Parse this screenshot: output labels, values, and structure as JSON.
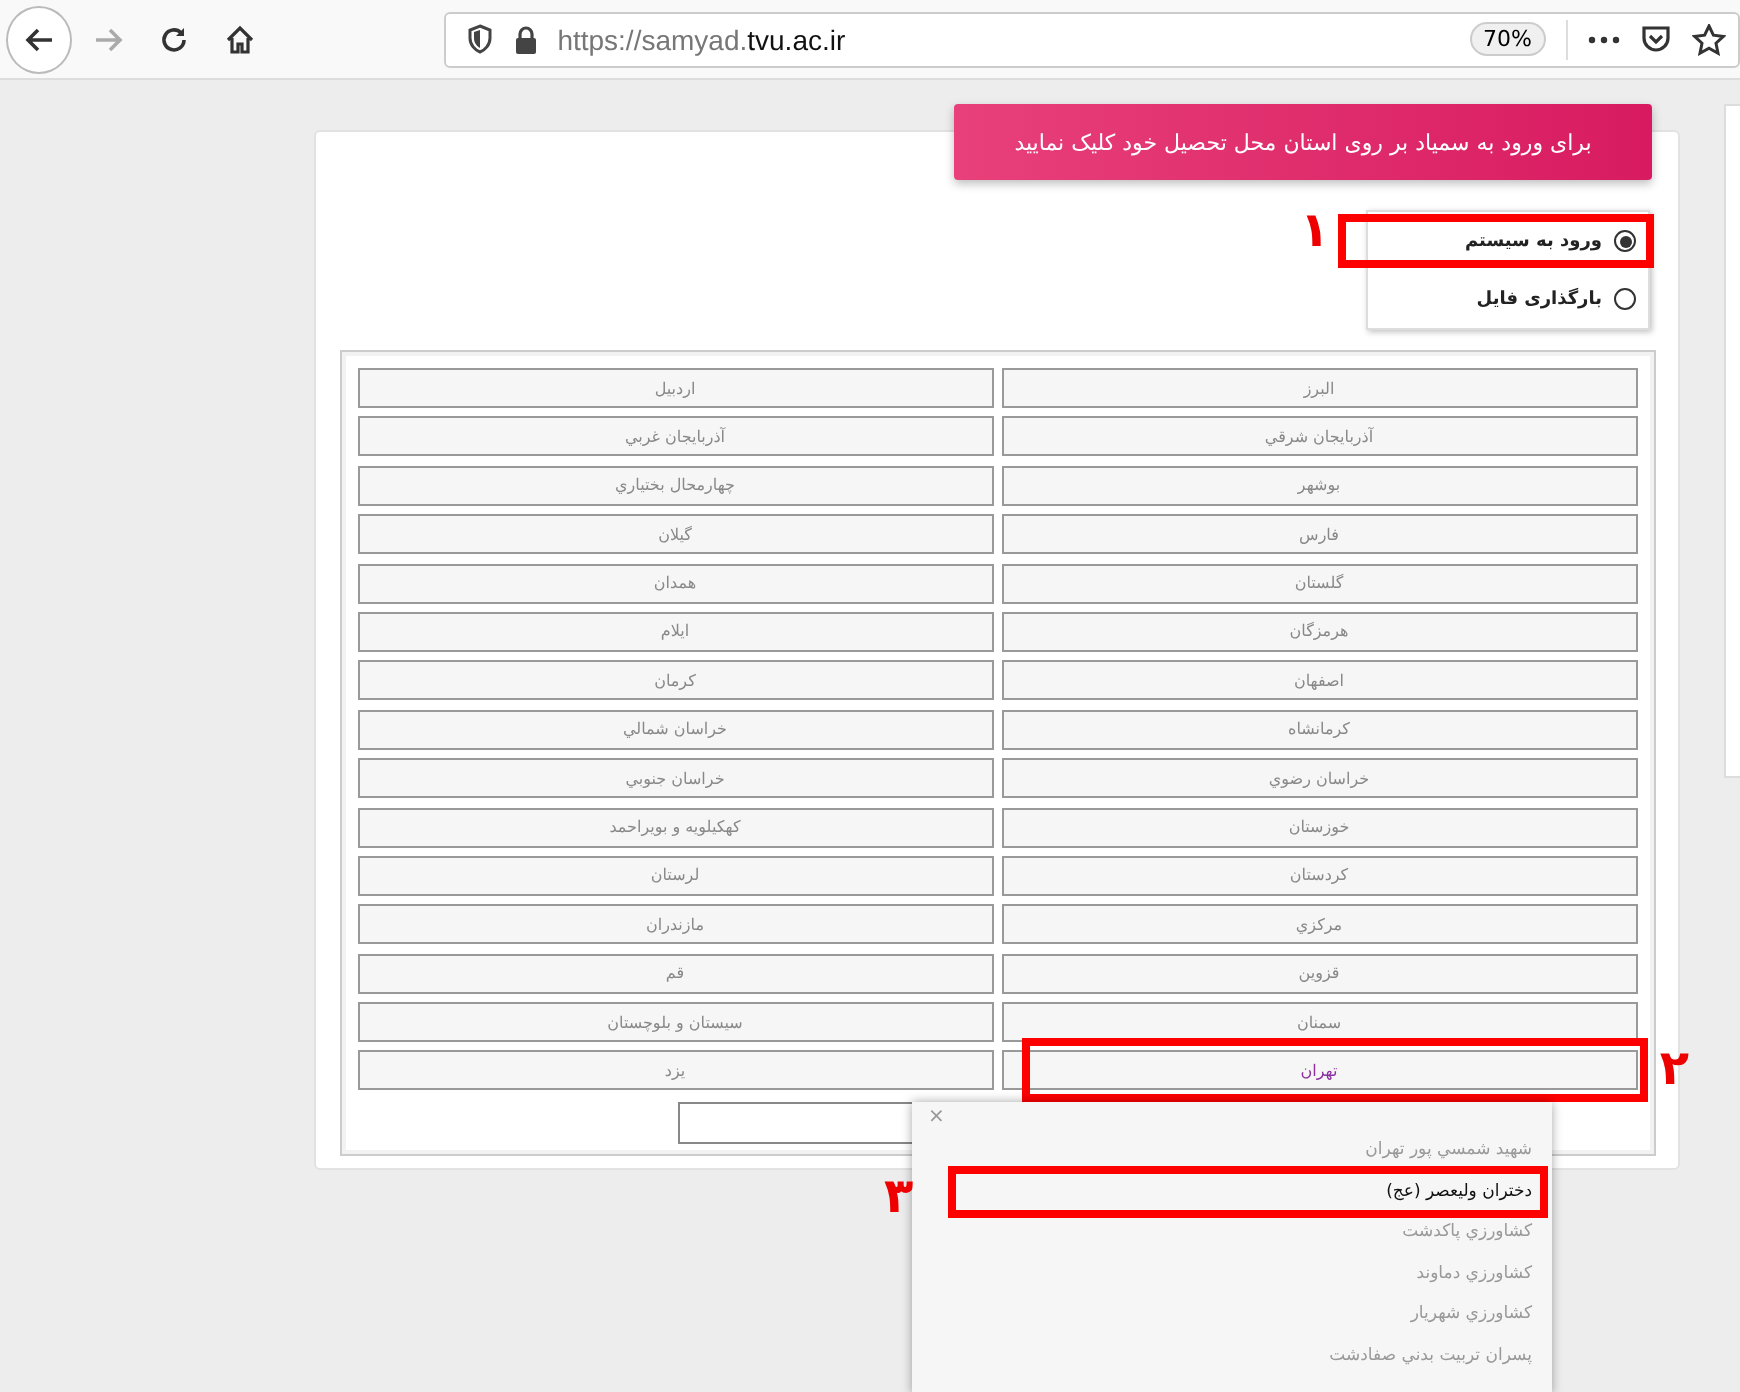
{
  "browser": {
    "url_prefix": "https://samyad.",
    "url_host": "tvu.ac.ir",
    "zoom": "70%",
    "forward_disabled": true
  },
  "banner": "برای ورود به سمیاد بر روی استان محل تحصیل خود کلیک نمایید",
  "modes": [
    {
      "label": "ورود به سیستم",
      "selected": true,
      "annotation": "۱"
    },
    {
      "label": "بارگذاری فایل",
      "selected": false
    }
  ],
  "provinces": [
    {
      "label": "البرز",
      "selected": false
    },
    {
      "label": "اردبيل",
      "selected": false
    },
    {
      "label": "آذربايجان شرقي",
      "selected": false
    },
    {
      "label": "آذربايجان غربي",
      "selected": false
    },
    {
      "label": "بوشهر",
      "selected": false
    },
    {
      "label": "چهارمحال بختياري",
      "selected": false
    },
    {
      "label": "فارس",
      "selected": false
    },
    {
      "label": "گيلان",
      "selected": false
    },
    {
      "label": "گلستان",
      "selected": false
    },
    {
      "label": "همدان",
      "selected": false
    },
    {
      "label": "هرمزگان",
      "selected": false
    },
    {
      "label": "ايلام",
      "selected": false
    },
    {
      "label": "اصفهان",
      "selected": false
    },
    {
      "label": "كرمان",
      "selected": false
    },
    {
      "label": "كرمانشاه",
      "selected": false
    },
    {
      "label": "خراسان شمالي",
      "selected": false
    },
    {
      "label": "خراسان رضوي",
      "selected": false
    },
    {
      "label": "خراسان جنوبي",
      "selected": false
    },
    {
      "label": "خوزستان",
      "selected": false
    },
    {
      "label": "كهكيلويه و بويراحمد",
      "selected": false
    },
    {
      "label": "كردستان",
      "selected": false
    },
    {
      "label": "لرستان",
      "selected": false
    },
    {
      "label": "مركزي",
      "selected": false
    },
    {
      "label": "مازندران",
      "selected": false
    },
    {
      "label": "قزوين",
      "selected": false
    },
    {
      "label": "قم",
      "selected": false
    },
    {
      "label": "سمنان",
      "selected": false
    },
    {
      "label": "سيستان و بلوچستان",
      "selected": false
    },
    {
      "label": "تهران",
      "selected": true,
      "annotation": "۲"
    },
    {
      "label": "يزد",
      "selected": false
    }
  ],
  "dropdown": {
    "close": "×",
    "items": [
      {
        "label": "شهيد شمسي پور تهران",
        "selected": false
      },
      {
        "label": "دختران وليعصر (عج)",
        "selected": true,
        "annotation": "۳"
      },
      {
        "label": "كشاورزي پاكدشت",
        "selected": false
      },
      {
        "label": "كشاورزي دماوند",
        "selected": false
      },
      {
        "label": "كشاورزي شهريار",
        "selected": false
      },
      {
        "label": "پسران تربيت بدني صفادشت",
        "selected": false
      }
    ]
  }
}
